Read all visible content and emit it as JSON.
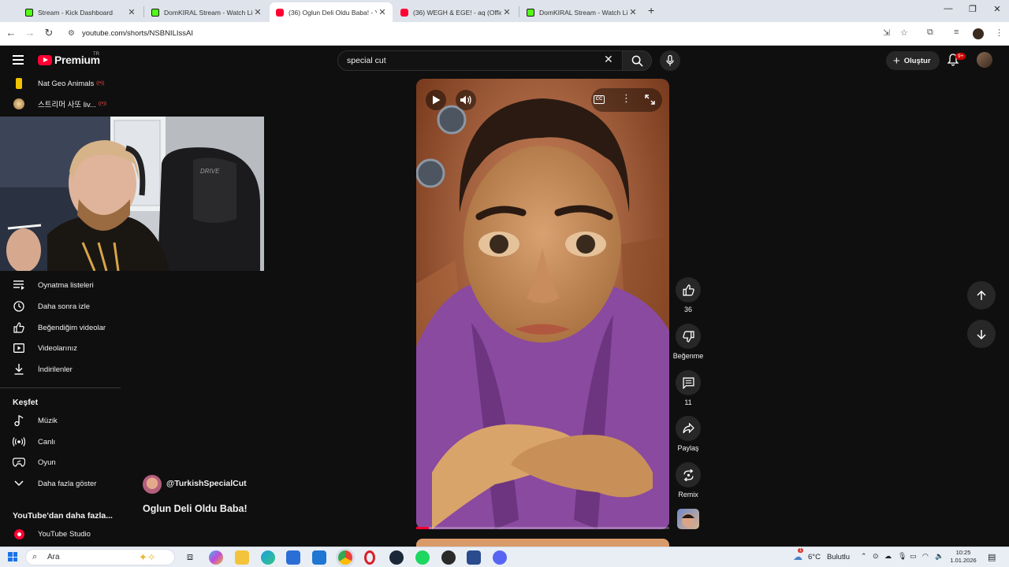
{
  "browser": {
    "tabs": [
      {
        "title": "Stream - Kick Dashboard",
        "favicon": "kick-icon",
        "active": false
      },
      {
        "title": "DomKIRAL Stream - Watch Live",
        "favicon": "kick-icon",
        "active": false
      },
      {
        "title": "(36) Oglun Deli Oldu Baba! - Yo",
        "favicon": "youtube-icon",
        "active": true
      },
      {
        "title": "(36) WEGH & EGE! - aq (Officia",
        "favicon": "youtube-icon",
        "active": false
      },
      {
        "title": "DomKIRAL Stream - Watch Live",
        "favicon": "kick-icon",
        "active": false
      }
    ],
    "new_tab": "+",
    "url": "youtube.com/shorts/NSBNILIssAI"
  },
  "youtube": {
    "logo_text": "Premium",
    "country_code": "TR",
    "search": {
      "value": "special cut",
      "placeholder": "Ara"
    },
    "create_label": "Oluştur",
    "notifications_badge": "9+"
  },
  "sidebar": {
    "subscriptions": [
      {
        "label": "Nat Geo Animals",
        "live_icon": "((•))"
      },
      {
        "label": "스트리머 사또 liv...",
        "live_icon": "((•))"
      }
    ],
    "you_items": [
      {
        "label": "Oynatma listeleri",
        "icon": "playlist-icon"
      },
      {
        "label": "Daha sonra izle",
        "icon": "clock-icon"
      },
      {
        "label": "Beğendiğim videolar",
        "icon": "thumbs-up-icon"
      },
      {
        "label": "Videolarınız",
        "icon": "video-icon"
      },
      {
        "label": "İndirilenler",
        "icon": "download-icon"
      }
    ],
    "explore_heading": "Keşfet",
    "explore_items": [
      {
        "label": "Müzik",
        "icon": "music-note-icon"
      },
      {
        "label": "Canlı",
        "icon": "live-icon"
      },
      {
        "label": "Oyun",
        "icon": "gamepad-icon"
      },
      {
        "label": "Daha fazla göster",
        "icon": "chevron-down-icon"
      }
    ],
    "more_heading": "YouTube'dan daha fazla...",
    "more_items": [
      {
        "label": "YouTube Studio",
        "icon": "youtube-studio-icon"
      }
    ]
  },
  "short": {
    "channel": "@TurkishSpecialCut",
    "title": "Oglun Deli Oldu Baba!",
    "progress": 0.05,
    "actions": {
      "like_count": "36",
      "dislike_label": "Beğenme",
      "comment_count": "11",
      "share_label": "Paylaş",
      "remix_label": "Remix"
    }
  },
  "taskbar": {
    "search_label": "Ara",
    "weather": {
      "temp": "6°C",
      "condition": "Bulutlu"
    },
    "weather_badge": "1",
    "time": "10:25",
    "date": "1.01.2026"
  }
}
